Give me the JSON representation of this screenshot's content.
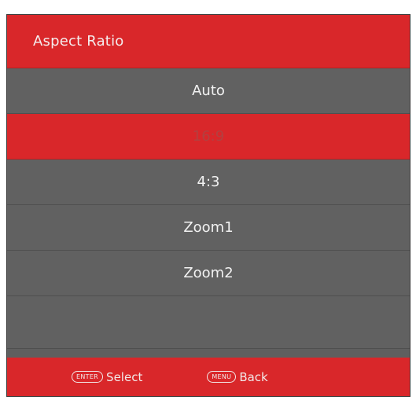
{
  "menu": {
    "title": "Aspect Ratio",
    "items": [
      {
        "label": "Auto"
      },
      {
        "label": "16:9"
      },
      {
        "label": "4:3"
      },
      {
        "label": "Zoom1"
      },
      {
        "label": "Zoom2"
      }
    ],
    "selected": "16:9"
  },
  "footer": {
    "enter_key": "ENTER",
    "select_label": "Select",
    "menu_key": "MENU",
    "back_label": "Back"
  },
  "colors": {
    "accent": "#d9272a",
    "panel": "#616161",
    "text": "#f2f2f2"
  }
}
